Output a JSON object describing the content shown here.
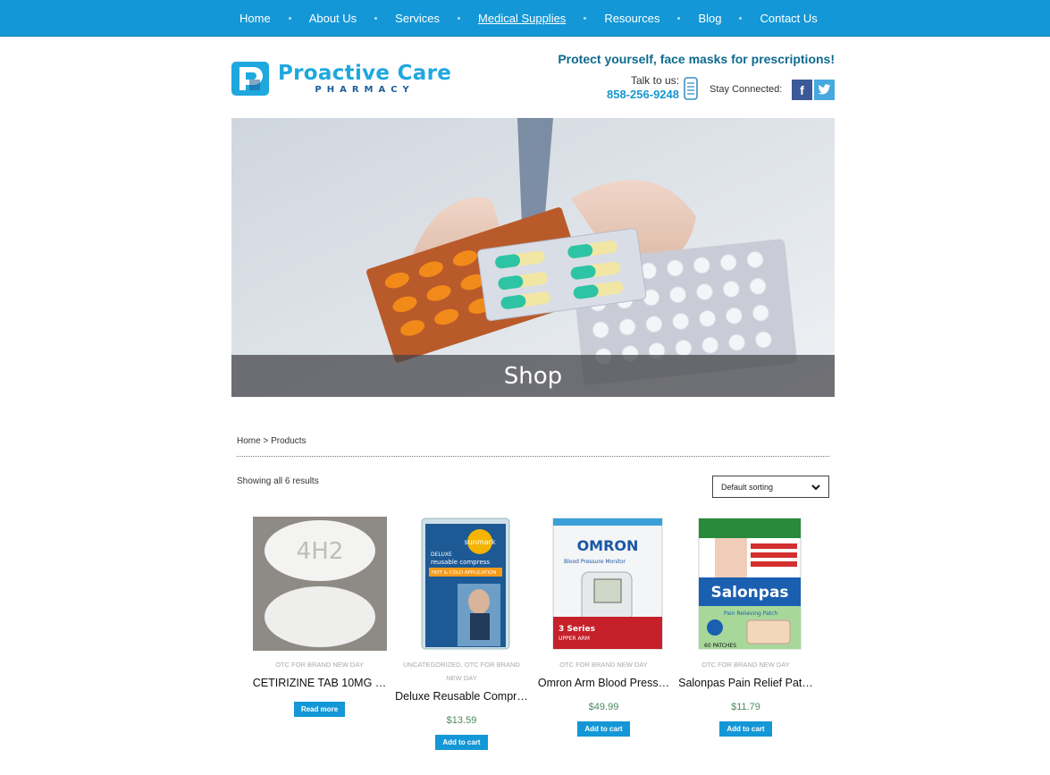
{
  "nav": {
    "items": [
      {
        "label": "Home"
      },
      {
        "label": "About Us"
      },
      {
        "label": "Services"
      },
      {
        "label": "Medical Supplies",
        "active": true
      },
      {
        "label": "Resources"
      },
      {
        "label": "Blog"
      },
      {
        "label": "Contact Us"
      }
    ]
  },
  "header": {
    "logo_title": "Proactive Care",
    "logo_subtitle": "PHARMACY",
    "promo": "Protect yourself, face masks for prescriptions!",
    "talk_label": "Talk to us:",
    "phone": "858-256-9248",
    "stay_connected": "Stay Connected:",
    "facebook": "f"
  },
  "hero": {
    "title": "Shop"
  },
  "breadcrumb": "Home > Products",
  "results_text": "Showing all 6 results",
  "sort": {
    "selected": "Default sorting"
  },
  "products": [
    {
      "category": "OTC FOR BRAND NEW DAY",
      "name": "CETIRIZINE TAB 10MG …",
      "price": "",
      "button": "Read more",
      "imprint": "4H2"
    },
    {
      "category": "UNCATEGORIZED, OTC FOR BRAND NEW DAY",
      "name": "Deluxe Reusable Compr…",
      "price": "$13.59",
      "button": "Add to cart",
      "brand": "sunmark",
      "box_line1": "DELUXE",
      "box_line2": "reusable compress",
      "box_line3": "HOT & COLD APPLICATION"
    },
    {
      "category": "OTC FOR BRAND NEW DAY",
      "name": "Omron Arm Blood Press…",
      "price": "$49.99",
      "button": "Add to cart",
      "brand": "OMRON",
      "box_line1": "Blood Pressure Monitor",
      "box_line2": "3 Series",
      "box_line3": "UPPER ARM"
    },
    {
      "category": "OTC FOR BRAND NEW DAY",
      "name": "Salonpas Pain Relief Pat…",
      "price": "$11.79",
      "button": "Add to cart",
      "brand": "Salonpas",
      "box_line1": "Pain Relieving Patch",
      "box_line2": "60 PATCHES"
    }
  ],
  "colors": {
    "nav_bg": "#1497d6",
    "accent": "#1fa8de",
    "button": "#1497d6",
    "price": "#4c8a63"
  }
}
